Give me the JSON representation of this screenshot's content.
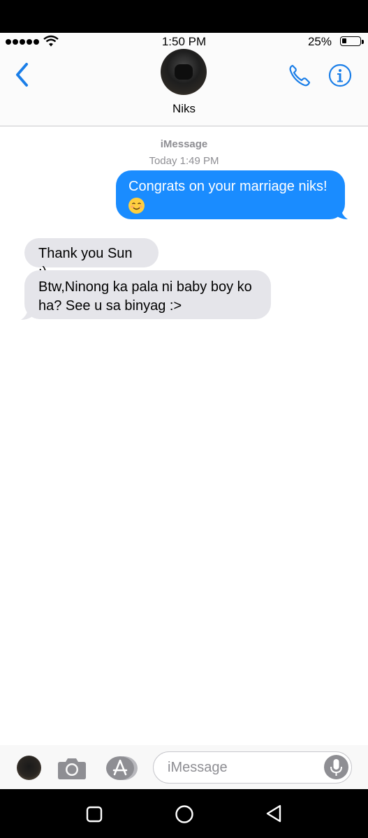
{
  "status_bar": {
    "time": "1:50 PM",
    "battery": "25%",
    "battery_level": 0.25
  },
  "header": {
    "contact_name": "Niks"
  },
  "thread": {
    "service": "iMessage",
    "timestamp": "Today 1:49 PM",
    "messages": [
      {
        "direction": "outgoing",
        "text": "Congrats on your marriage niks!",
        "emoji": "smiling-face"
      },
      {
        "direction": "incoming",
        "text": "Thank you Sun :)"
      },
      {
        "direction": "incoming",
        "line1": "Btw,Ninong ka pala ni baby boy ko",
        "line2": "ha? See u sa binyag :>"
      }
    ]
  },
  "input_bar": {
    "placeholder": "iMessage"
  },
  "colors": {
    "accent": "#1a8cff",
    "incoming_bubble": "#e5e5ea",
    "outgoing_bubble": "#1a8cff",
    "icon_blue": "#1a7ee8"
  }
}
